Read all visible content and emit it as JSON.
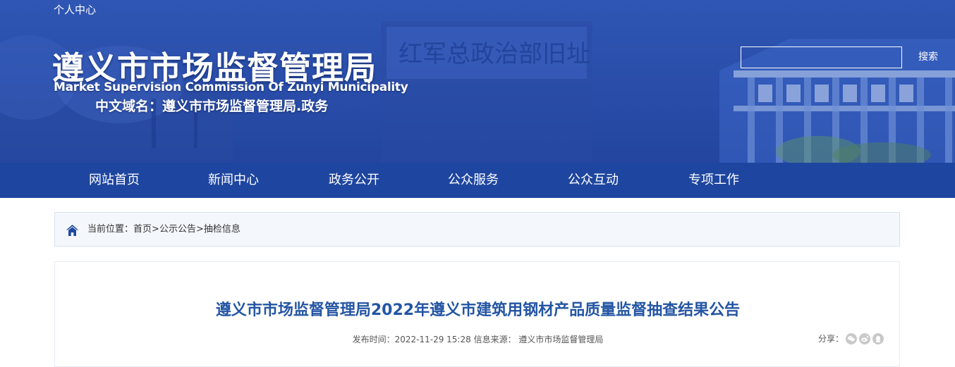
{
  "header": {
    "personal_center": "个人中心",
    "title_cn": "遵义市市场监督管理局",
    "title_en": "Market Supervision Commission Of Zunyi Municipality",
    "domain_name": "中文域名：遵义市市场监督管理局.政务",
    "search_button": "搜索",
    "search_value": ""
  },
  "nav": {
    "items": [
      {
        "label": "网站首页"
      },
      {
        "label": "新闻中心"
      },
      {
        "label": "政务公开"
      },
      {
        "label": "公众服务"
      },
      {
        "label": "公众互动"
      },
      {
        "label": "专项工作"
      }
    ]
  },
  "breadcrumb": {
    "prefix": "当前位置：",
    "home": "首页",
    "sep1": ">",
    "section": "公示公告",
    "sep2": ">",
    "current": "抽检信息"
  },
  "article": {
    "title": "遵义市市场监督管理局2022年遵义市建筑用钢材产品质量监督抽查结果公告",
    "publish_label": "发布时间：",
    "publish_time": "2022-11-29 15:28",
    "source_label": "信息来源：",
    "source": "遵义市市场监督管理局",
    "share_label": "分享：",
    "share_icons": [
      "wechat-icon",
      "weibo-icon",
      "qq-icon"
    ]
  },
  "colors": {
    "banner": "#2a4fab",
    "nav": "#1e46a0",
    "title_blue": "#2455a4",
    "crumb_bg": "#f4f8fc"
  }
}
